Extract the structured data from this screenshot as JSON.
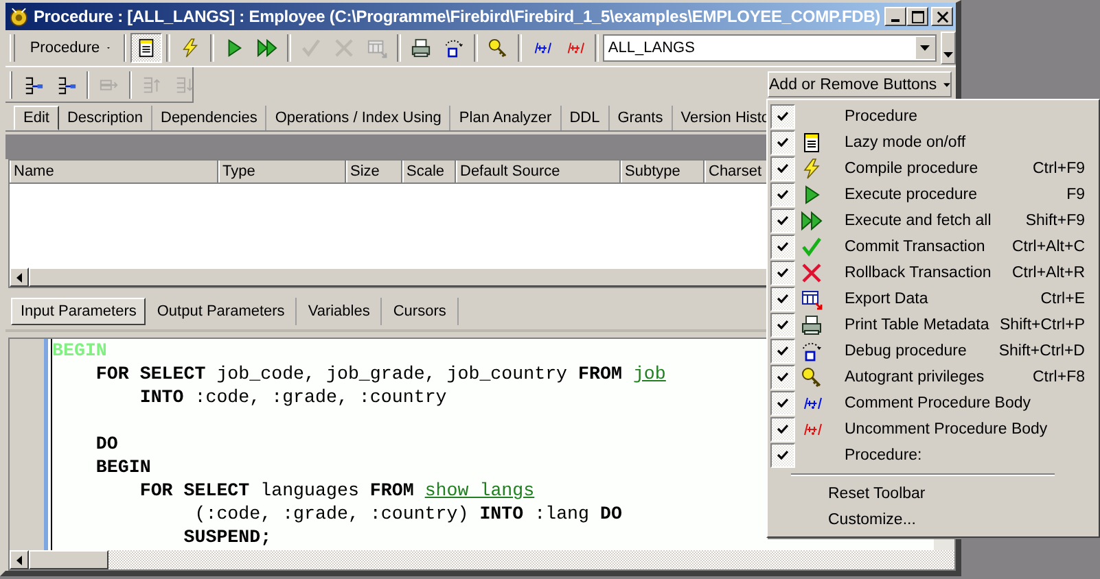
{
  "window": {
    "title": "Procedure : [ALL_LANGS] : Employee (C:\\Programme\\Firebird\\Firebird_1_5\\examples\\EMPLOYEE_COMP.FDB)"
  },
  "toolbar": [
    {
      "kind": "dropdown",
      "label": "Procedure",
      "on": false,
      "disabled": false
    },
    {
      "kind": "lazy",
      "on": true,
      "disabled": false
    },
    {
      "kind": "compile",
      "on": false,
      "disabled": false
    },
    {
      "kind": "run",
      "on": false,
      "disabled": false
    },
    {
      "kind": "runall",
      "on": false,
      "disabled": false
    },
    {
      "kind": "commit",
      "on": false,
      "disabled": true
    },
    {
      "kind": "rollback",
      "on": false,
      "disabled": true
    },
    {
      "kind": "export",
      "on": false,
      "disabled": true
    },
    {
      "kind": "print",
      "on": false,
      "disabled": false
    },
    {
      "kind": "debug",
      "on": false,
      "disabled": false
    },
    {
      "kind": "grant",
      "on": false,
      "disabled": false
    },
    {
      "kind": "comment",
      "on": false,
      "disabled": false
    },
    {
      "kind": "uncomment",
      "on": false,
      "disabled": false
    }
  ],
  "procedure_combo": {
    "value": "ALL_LANGS"
  },
  "toolbar_2": [
    {
      "kind": "indent-in",
      "disabled": false
    },
    {
      "kind": "indent-out",
      "disabled": false
    },
    {
      "kind": "move-right",
      "disabled": true
    },
    {
      "kind": "move-up",
      "disabled": true
    },
    {
      "kind": "move-down",
      "disabled": true
    }
  ],
  "tabs": [
    {
      "label": "Edit",
      "selected": true
    },
    {
      "label": "Description",
      "selected": false
    },
    {
      "label": "Dependencies",
      "selected": false
    },
    {
      "label": "Operations / Index Using",
      "selected": false
    },
    {
      "label": "Plan Analyzer",
      "selected": false
    },
    {
      "label": "DDL",
      "selected": false
    },
    {
      "label": "Grants",
      "selected": false
    },
    {
      "label": "Version Histo",
      "selected": false
    }
  ],
  "table": {
    "columns": [
      "Name",
      "Type",
      "Size",
      "Scale",
      "Default Source",
      "Subtype",
      "Charset"
    ]
  },
  "param_tabs": [
    {
      "label": "Input Parameters",
      "selected": true
    },
    {
      "label": "Output Parameters",
      "selected": false
    },
    {
      "label": "Variables",
      "selected": false
    },
    {
      "label": "Cursors",
      "selected": false
    }
  ],
  "code": [
    {
      "kind": "line",
      "tokens": [
        {
          "kind": "start",
          "text": "BEGIN"
        }
      ]
    },
    {
      "kind": "line",
      "tokens": [
        {
          "kind": "keyword",
          "text": "    FOR SELECT"
        },
        {
          "kind": "plain",
          "text": " job_code, job_grade, job_country "
        },
        {
          "kind": "keyword",
          "text": "FROM "
        },
        {
          "kind": "link",
          "text": "job"
        }
      ]
    },
    {
      "kind": "line",
      "tokens": [
        {
          "kind": "keyword",
          "text": "        INTO"
        },
        {
          "kind": "plain",
          "text": " :code, :grade, :country"
        }
      ]
    },
    {
      "kind": "blank"
    },
    {
      "kind": "line",
      "tokens": [
        {
          "kind": "keyword",
          "text": "    DO"
        }
      ]
    },
    {
      "kind": "line",
      "tokens": [
        {
          "kind": "keyword",
          "text": "    BEGIN"
        }
      ]
    },
    {
      "kind": "line",
      "tokens": [
        {
          "kind": "keyword",
          "text": "        FOR SELECT"
        },
        {
          "kind": "plain",
          "text": " languages "
        },
        {
          "kind": "keyword",
          "text": "FROM "
        },
        {
          "kind": "link",
          "text": "show langs"
        }
      ]
    },
    {
      "kind": "line",
      "tokens": [
        {
          "kind": "plain",
          "text": "             (:code, :grade, :country) "
        },
        {
          "kind": "keyword",
          "text": "INTO"
        },
        {
          "kind": "plain",
          "text": " :lang "
        },
        {
          "kind": "keyword",
          "text": "DO"
        }
      ]
    },
    {
      "kind": "line",
      "tokens": [
        {
          "kind": "keyword",
          "text": "            SUSPEND;"
        }
      ]
    }
  ],
  "menu": {
    "button": "Add or Remove Buttons",
    "items": [
      {
        "kind": "plain",
        "label": "Procedure",
        "checked": true
      },
      {
        "kind": "lazy",
        "label": "Lazy mode on/off",
        "checked": true
      },
      {
        "kind": "compile",
        "label": "Compile procedure",
        "shortcut": "Ctrl+F9",
        "checked": true
      },
      {
        "kind": "run",
        "label": "Execute procedure",
        "shortcut": "F9",
        "checked": true
      },
      {
        "kind": "runall",
        "label": "Execute and fetch all",
        "shortcut": "Shift+F9",
        "checked": true
      },
      {
        "kind": "commit",
        "label": "Commit Transaction",
        "shortcut": "Ctrl+Alt+C",
        "checked": true
      },
      {
        "kind": "rollback",
        "label": "Rollback Transaction",
        "shortcut": "Ctrl+Alt+R",
        "checked": true
      },
      {
        "kind": "export",
        "label": "Export Data",
        "shortcut": "Ctrl+E",
        "checked": true
      },
      {
        "kind": "print",
        "label": "Print Table Metadata",
        "shortcut": "Shift+Ctrl+P",
        "checked": true
      },
      {
        "kind": "debug",
        "label": "Debug procedure",
        "shortcut": "Shift+Ctrl+D",
        "checked": true
      },
      {
        "kind": "grant",
        "label": "Autogrant privileges",
        "shortcut": "Ctrl+F8",
        "checked": true
      },
      {
        "kind": "comment",
        "label": "Comment Procedure Body",
        "checked": true
      },
      {
        "kind": "uncomment",
        "label": "Uncomment Procedure Body",
        "checked": true
      },
      {
        "kind": "plain",
        "label": "Procedure:",
        "checked": true
      }
    ],
    "actions": [
      "Reset Toolbar",
      "Customize..."
    ]
  }
}
